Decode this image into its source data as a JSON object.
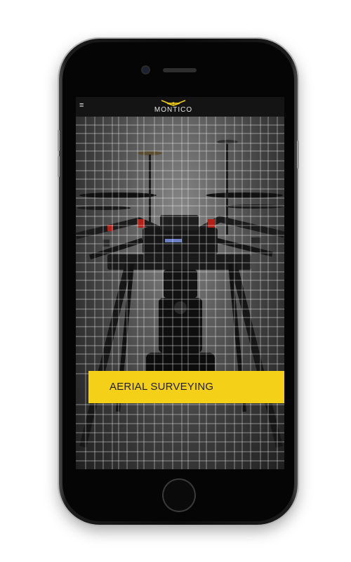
{
  "app": {
    "brand": "MONTICO"
  },
  "hero": {
    "banner_text": "AERIAL SURVEYING"
  },
  "colors": {
    "accent": "#f4d018",
    "navbar": "#141414",
    "logo": "#f4d018"
  },
  "icons": {
    "menu": "hamburger-icon",
    "logo": "drone-logo-icon"
  }
}
